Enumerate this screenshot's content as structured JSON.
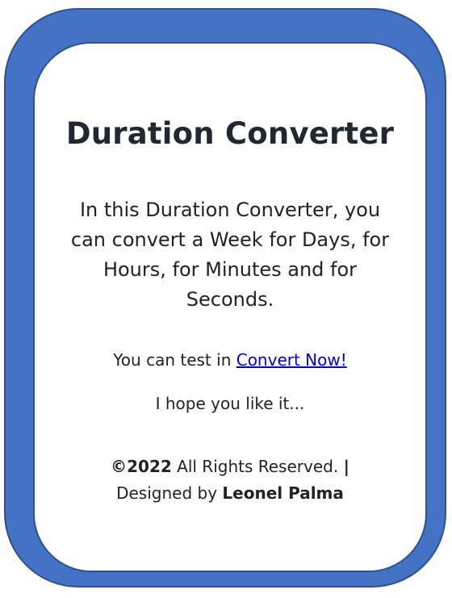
{
  "heading": "Duration Converter",
  "description": "In this Duration Converter, you can convert a Week for Days, for Hours, for Minutes and for Seconds.",
  "test_line": {
    "prefix": "You can test in ",
    "link_label": "Convert Now!"
  },
  "hope_text": "I hope you like it...",
  "footer": {
    "copyright": "©2022",
    "rights": " All Rights Reserved. ",
    "separator": "|",
    "designed_by": "Designed by ",
    "author": "Leonel Palma"
  },
  "colors": {
    "frame": "#4472c4",
    "frame_border": "#2f528f",
    "link": "#0000ee"
  }
}
